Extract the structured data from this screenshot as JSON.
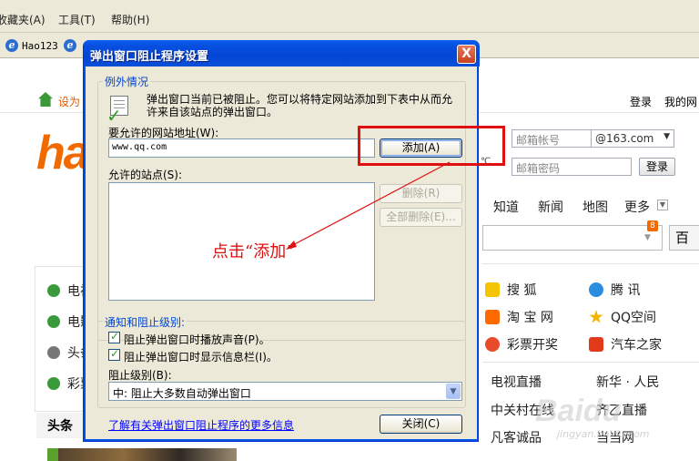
{
  "browser": {
    "menu": {
      "favorites": "收藏夹(A)",
      "tools": "工具(T)",
      "help": "帮助(H)"
    },
    "favorites_bar": {
      "item1": "Hao123"
    }
  },
  "site": {
    "set_home": "设为",
    "login": "登录",
    "my_site": "我的网",
    "logo_text": "ha",
    "email": {
      "account_placeholder": "邮箱帐号",
      "domain": "@163.com",
      "password_placeholder": "邮箱密码",
      "login_button": "登录"
    },
    "temp_unit": "℃",
    "nav": [
      "知道",
      "新闻",
      "地图",
      "更多"
    ],
    "search_button": "百",
    "badge": "8",
    "left_items": [
      "电视",
      "电影",
      "头条",
      "彩票"
    ],
    "headline_tab": "头条",
    "sites_row1": [
      "搜  狐",
      "腾  讯"
    ],
    "sites_row2": [
      "淘 宝 网",
      "QQ空间"
    ],
    "sites_row3": [
      "彩票开奖",
      "汽车之家"
    ],
    "links_row1": [
      "电视直播",
      "新华 · 人民"
    ],
    "links_row2": [
      "中关村在线",
      "齐乙直播"
    ],
    "links_row3": [
      "凡客诚品",
      "当当网"
    ],
    "icon_colors": {
      "sohu": "#f5c400",
      "tencent": "#2a8de0",
      "taobao": "#ff6a00",
      "qzone": "#f2b600",
      "lottery": "#e84a2a",
      "auto": "#e03a1a"
    }
  },
  "dialog": {
    "title": "弹出窗口阻止程序设置",
    "close_glyph": "X",
    "exceptions_legend": "例外情况",
    "info_text_line1": "弹出窗口当前已被阻止。您可以将特定网站添加到下表中从而允",
    "info_text_line2": "许来自该站点的弹出窗口。",
    "address_label": "要允许的网站地址(W):",
    "address_value": "www.qq.com",
    "add_button": "添加(A)",
    "allowed_label": "允许的站点(S):",
    "remove_button": "删除(R)",
    "remove_all_button": "全部删除(E)...",
    "notify_legend": "通知和阻止级别:",
    "check_sound": "阻止弹出窗口时播放声音(P)。",
    "check_infobar": "阻止弹出窗口时显示信息栏(I)。",
    "block_level_label": "阻止级别(B):",
    "block_level_value": "中: 阻止大多数自动弹出窗口",
    "learn_more_link": "了解有关弹出窗口阻止程序的更多信息",
    "close_button": "关闭(C)"
  },
  "annotation": {
    "note": "点击“添加”",
    "color": "#e01010"
  },
  "watermark": {
    "brand": "Baidu",
    "sub": "jingyan.baidu.com"
  }
}
